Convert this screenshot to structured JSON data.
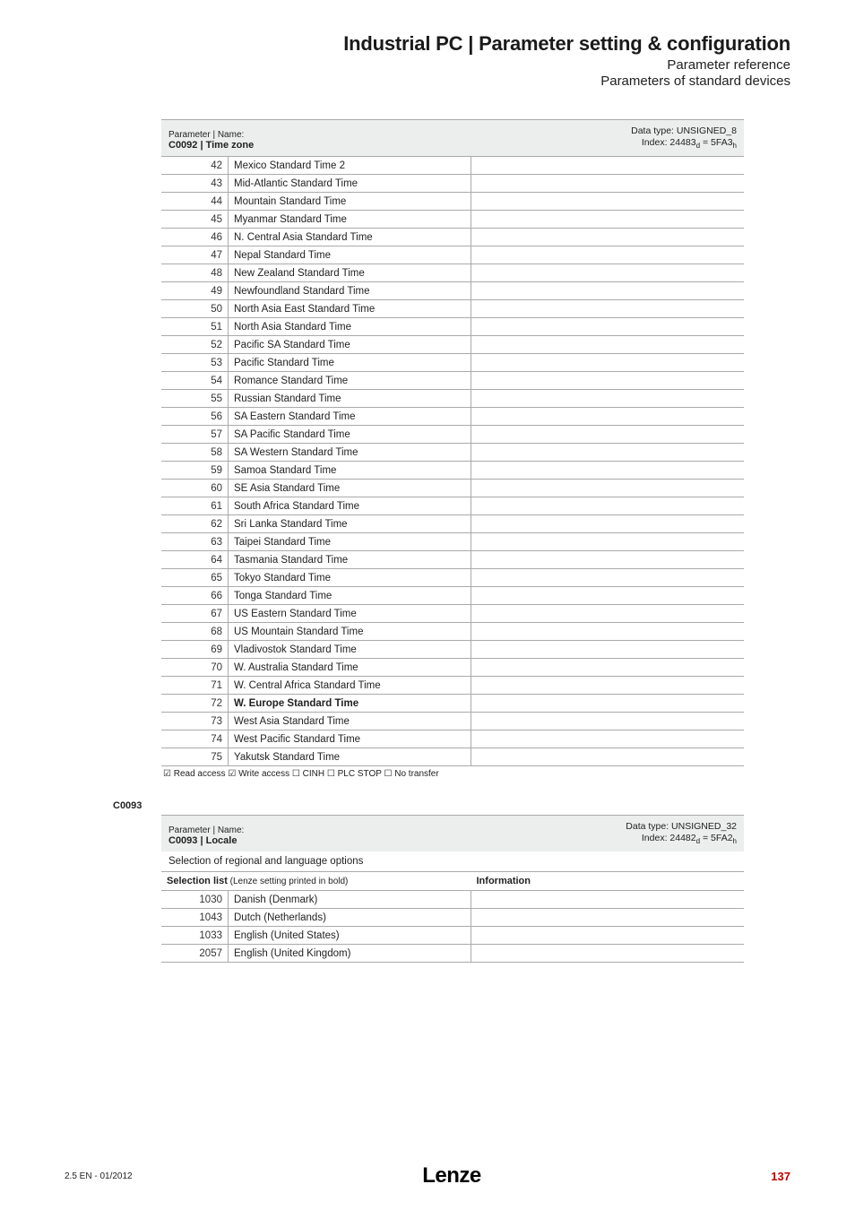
{
  "header": {
    "title": "Industrial PC | Parameter setting & configuration",
    "line1": "Parameter reference",
    "line2": "Parameters of standard devices"
  },
  "param1": {
    "label": "Parameter | Name:",
    "name": "C0092 | Time zone",
    "dtype": "Data type: UNSIGNED_8",
    "index_pre": "Index: 24483",
    "index_mid": " = 5FA3",
    "rows": [
      {
        "idx": "42",
        "name": "Mexico Standard Time 2",
        "bold": false
      },
      {
        "idx": "43",
        "name": "Mid-Atlantic Standard Time",
        "bold": false
      },
      {
        "idx": "44",
        "name": "Mountain Standard Time",
        "bold": false
      },
      {
        "idx": "45",
        "name": "Myanmar Standard Time",
        "bold": false
      },
      {
        "idx": "46",
        "name": "N. Central Asia Standard Time",
        "bold": false
      },
      {
        "idx": "47",
        "name": "Nepal Standard Time",
        "bold": false
      },
      {
        "idx": "48",
        "name": "New Zealand Standard Time",
        "bold": false
      },
      {
        "idx": "49",
        "name": "Newfoundland Standard Time",
        "bold": false
      },
      {
        "idx": "50",
        "name": "North Asia East Standard Time",
        "bold": false
      },
      {
        "idx": "51",
        "name": "North Asia Standard Time",
        "bold": false
      },
      {
        "idx": "52",
        "name": "Pacific SA Standard Time",
        "bold": false
      },
      {
        "idx": "53",
        "name": "Pacific Standard Time",
        "bold": false
      },
      {
        "idx": "54",
        "name": "Romance Standard Time",
        "bold": false
      },
      {
        "idx": "55",
        "name": "Russian Standard Time",
        "bold": false
      },
      {
        "idx": "56",
        "name": "SA Eastern Standard Time",
        "bold": false
      },
      {
        "idx": "57",
        "name": "SA Pacific Standard Time",
        "bold": false
      },
      {
        "idx": "58",
        "name": "SA Western Standard Time",
        "bold": false
      },
      {
        "idx": "59",
        "name": "Samoa Standard Time",
        "bold": false
      },
      {
        "idx": "60",
        "name": "SE Asia Standard Time",
        "bold": false
      },
      {
        "idx": "61",
        "name": "South Africa Standard Time",
        "bold": false
      },
      {
        "idx": "62",
        "name": "Sri Lanka Standard Time",
        "bold": false
      },
      {
        "idx": "63",
        "name": "Taipei Standard Time",
        "bold": false
      },
      {
        "idx": "64",
        "name": "Tasmania Standard Time",
        "bold": false
      },
      {
        "idx": "65",
        "name": "Tokyo Standard Time",
        "bold": false
      },
      {
        "idx": "66",
        "name": "Tonga Standard Time",
        "bold": false
      },
      {
        "idx": "67",
        "name": "US Eastern Standard Time",
        "bold": false
      },
      {
        "idx": "68",
        "name": "US Mountain Standard Time",
        "bold": false
      },
      {
        "idx": "69",
        "name": "Vladivostok Standard Time",
        "bold": false
      },
      {
        "idx": "70",
        "name": "W. Australia Standard Time",
        "bold": false
      },
      {
        "idx": "71",
        "name": "W. Central Africa Standard Time",
        "bold": false
      },
      {
        "idx": "72",
        "name": "W. Europe Standard Time",
        "bold": true
      },
      {
        "idx": "73",
        "name": "West Asia Standard Time",
        "bold": false
      },
      {
        "idx": "74",
        "name": "West Pacific Standard Time",
        "bold": false
      },
      {
        "idx": "75",
        "name": "Yakutsk Standard Time",
        "bold": false
      }
    ],
    "access": "☑ Read access   ☑ Write access   ☐ CINH   ☐ PLC STOP   ☐ No transfer"
  },
  "section2_label": "C0093",
  "param2": {
    "label": "Parameter | Name:",
    "name": "C0093 | Locale",
    "dtype": "Data type: UNSIGNED_32",
    "index_pre": "Index: 24482",
    "index_mid": " = 5FA2",
    "desc": "Selection of regional and language options",
    "sel_hdr_left": "Selection list",
    "sel_hdr_left_light": " (Lenze setting printed in bold)",
    "sel_hdr_right": "Information",
    "rows": [
      {
        "idx": "1030",
        "name": "Danish (Denmark)"
      },
      {
        "idx": "1043",
        "name": "Dutch (Netherlands)"
      },
      {
        "idx": "1033",
        "name": "English (United States)"
      },
      {
        "idx": "2057",
        "name": "English (United Kingdom)"
      }
    ]
  },
  "footer": {
    "left": "2.5 EN - 01/2012",
    "logo": "Lenze",
    "page": "137"
  }
}
